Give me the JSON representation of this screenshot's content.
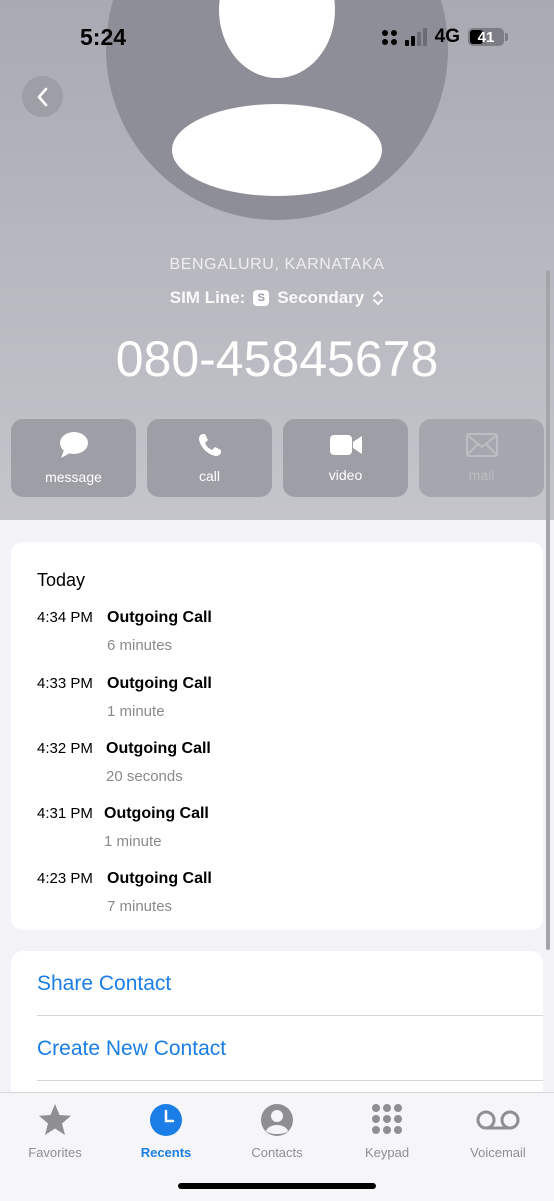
{
  "status_bar": {
    "time": "5:24",
    "network": "4G",
    "battery": "41"
  },
  "contact": {
    "location": "BENGALURU, KARNATAKA",
    "sim_label": "SIM Line:",
    "sim_badge": "S",
    "sim_value": "Secondary",
    "phone_number": "080-45845678"
  },
  "actions": [
    {
      "label": "message",
      "icon": "message-icon"
    },
    {
      "label": "call",
      "icon": "phone-icon"
    },
    {
      "label": "video",
      "icon": "video-icon"
    },
    {
      "label": "mail",
      "icon": "mail-icon",
      "disabled": true
    }
  ],
  "history": {
    "title": "Today",
    "calls": [
      {
        "time": "4:34 PM",
        "type": "Outgoing Call",
        "duration": "6 minutes"
      },
      {
        "time": "4:33 PM",
        "type": "Outgoing Call",
        "duration": "1 minute"
      },
      {
        "time": "4:32 PM",
        "type": "Outgoing Call",
        "duration": "20 seconds"
      },
      {
        "time": "4:31 PM",
        "type": "Outgoing Call",
        "duration": "1 minute"
      },
      {
        "time": "4:23 PM",
        "type": "Outgoing Call",
        "duration": "7 minutes"
      }
    ]
  },
  "options": [
    "Share Contact",
    "Create New Contact"
  ],
  "tabs": [
    {
      "label": "Favorites",
      "icon": "star-icon"
    },
    {
      "label": "Recents",
      "icon": "clock-icon",
      "active": true
    },
    {
      "label": "Contacts",
      "icon": "person-circle-icon"
    },
    {
      "label": "Keypad",
      "icon": "keypad-icon"
    },
    {
      "label": "Voicemail",
      "icon": "voicemail-icon"
    }
  ],
  "colors": {
    "accent": "#1a7ee6",
    "header_bg": "#b3b3bb",
    "action_bg": "#9e9ea7"
  }
}
